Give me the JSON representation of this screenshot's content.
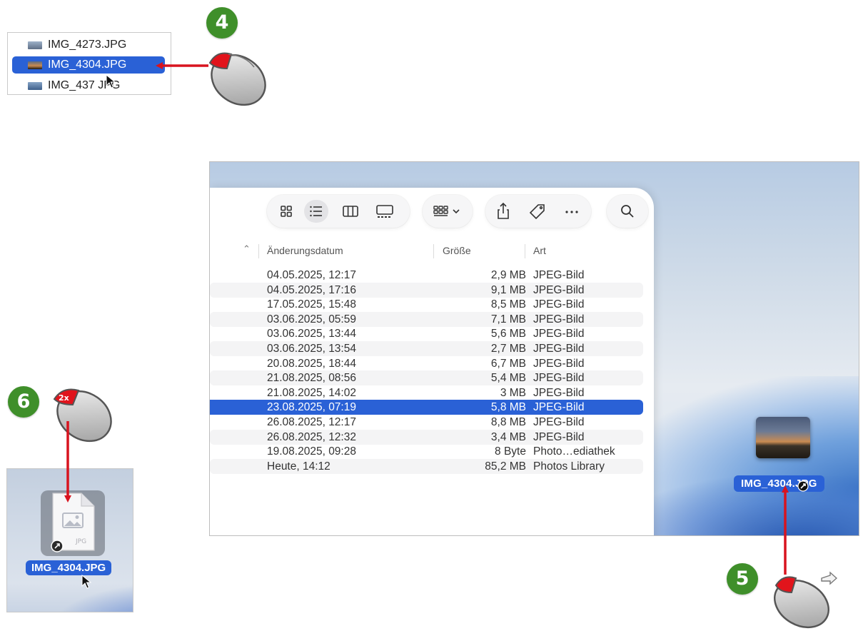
{
  "step4": {
    "badge": "4",
    "files": [
      {
        "name": "IMG_4273.JPG",
        "selected": false
      },
      {
        "name": "IMG_4304.JPG",
        "selected": true
      },
      {
        "name": "IMG_437  JPG",
        "selected": false
      }
    ]
  },
  "step5": {
    "badge": "5"
  },
  "step6": {
    "badge": "6",
    "click_label": "2x",
    "doc_ext": "JPG",
    "file_label": "IMG_4304.JPG"
  },
  "finder": {
    "columns": {
      "date": "Änderungsdatum",
      "size": "Größe",
      "kind": "Art"
    },
    "rows": [
      {
        "date": "04.05.2025, 12:17",
        "size": "2,9 MB",
        "kind": "JPEG-Bild"
      },
      {
        "date": "04.05.2025, 17:16",
        "size": "9,1 MB",
        "kind": "JPEG-Bild"
      },
      {
        "date": "17.05.2025, 15:48",
        "size": "8,5 MB",
        "kind": "JPEG-Bild"
      },
      {
        "date": "03.06.2025, 05:59",
        "size": "7,1 MB",
        "kind": "JPEG-Bild"
      },
      {
        "date": "03.06.2025, 13:44",
        "size": "5,6 MB",
        "kind": "JPEG-Bild"
      },
      {
        "date": "03.06.2025, 13:54",
        "size": "2,7 MB",
        "kind": "JPEG-Bild"
      },
      {
        "date": "20.08.2025, 18:44",
        "size": "6,7 MB",
        "kind": "JPEG-Bild"
      },
      {
        "date": "21.08.2025, 08:56",
        "size": "5,4 MB",
        "kind": "JPEG-Bild"
      },
      {
        "date": "21.08.2025, 14:02",
        "size": "3 MB",
        "kind": "JPEG-Bild"
      },
      {
        "date": "23.08.2025, 07:19",
        "size": "5,8 MB",
        "kind": "JPEG-Bild",
        "selected": true
      },
      {
        "date": "26.08.2025, 12:17",
        "size": "8,8 MB",
        "kind": "JPEG-Bild"
      },
      {
        "date": "26.08.2025, 12:32",
        "size": "3,4 MB",
        "kind": "JPEG-Bild"
      },
      {
        "date": "19.08.2025, 09:28",
        "size": "8 Byte",
        "kind": "Photo…ediathek"
      },
      {
        "date": "Heute, 14:12",
        "size": "85,2 MB",
        "kind": "Photos Library"
      }
    ],
    "desktop_file_label": "IMG_4304.JPG"
  },
  "colors": {
    "badge_green": "#3f8f2a",
    "selection_blue": "#2a61d6",
    "arrow_red": "#d8141f"
  },
  "icons": [
    "icon-view-icon",
    "list-view-icon",
    "column-view-icon",
    "gallery-view-icon",
    "group-icon",
    "share-icon",
    "tag-icon",
    "more-icon",
    "search-icon",
    "mouse-icon",
    "cursor-icon"
  ]
}
